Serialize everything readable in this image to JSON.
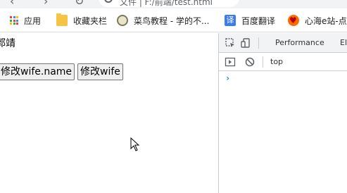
{
  "browser": {
    "url_text": "文件 | F:/前端/test.html"
  },
  "bookmarks": [
    {
      "label": "应用",
      "icon": "apps-grid-icon"
    },
    {
      "label": "收藏夹栏",
      "icon": "folder-icon"
    },
    {
      "label": "菜鸟教程 - 学的不...",
      "icon": "runoob-icon"
    },
    {
      "label": "百度翻译",
      "icon": "baidu-fanyi-icon",
      "icon_char": "译"
    },
    {
      "label": "心海e站-点文",
      "icon": "heart-icon"
    }
  ],
  "page": {
    "name_text": "郭靖",
    "buttons": [
      {
        "label": "修改wife.name"
      },
      {
        "label": "修改wife"
      }
    ]
  },
  "devtools": {
    "tabs": [
      "Performance",
      "Ele"
    ],
    "console_context": "top",
    "prompt_symbol": "›"
  },
  "colors": {
    "chrome_bg": "#f1f3f4",
    "accent_blue": "#1a73e8",
    "button_bg": "#efefef"
  }
}
